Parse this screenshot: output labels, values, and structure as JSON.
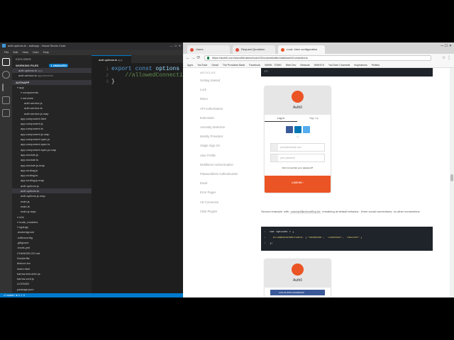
{
  "vscode": {
    "title": "auth.options.ts - authapp - Visual Studio Code",
    "menu": [
      "File",
      "Edit",
      "View",
      "Goto",
      "Help"
    ],
    "explorer_label": "EXPLORER",
    "working_files": "WORKING FILES",
    "working_badge": "1 UNSAVED",
    "open_files": [
      {
        "name": "auth.options.ts",
        "dir": "app"
      },
      {
        "name": "auth.service.ts",
        "dir": "app/services"
      }
    ],
    "project": "AUTHAPP",
    "tree": [
      {
        "name": "app",
        "indent": 1,
        "folder": true
      },
      {
        "name": "components",
        "indent": 2,
        "folder": true
      },
      {
        "name": "services",
        "indent": 2,
        "folder": true
      },
      {
        "name": "auth.service.js",
        "indent": 3
      },
      {
        "name": "auth.service.ts",
        "indent": 3
      },
      {
        "name": "auth.service.js.map",
        "indent": 3
      },
      {
        "name": "app.component.html",
        "indent": 2
      },
      {
        "name": "app.component.js",
        "indent": 2
      },
      {
        "name": "app.component.ts",
        "indent": 2
      },
      {
        "name": "app.component.js.map",
        "indent": 2
      },
      {
        "name": "app.component.spec.js",
        "indent": 2
      },
      {
        "name": "app.component.spec.ts",
        "indent": 2
      },
      {
        "name": "app.component.spec.js.map",
        "indent": 2
      },
      {
        "name": "app.module.js",
        "indent": 2
      },
      {
        "name": "app.module.ts",
        "indent": 2
      },
      {
        "name": "app.module.js.map",
        "indent": 2
      },
      {
        "name": "app.routing.js",
        "indent": 2
      },
      {
        "name": "app.routing.ts",
        "indent": 2
      },
      {
        "name": "app.routing.js.map",
        "indent": 2
      },
      {
        "name": "auth.options.js",
        "indent": 2
      },
      {
        "name": "auth.options.ts",
        "indent": 2,
        "selected": true
      },
      {
        "name": "auth.options.js.map",
        "indent": 2
      },
      {
        "name": "main.js",
        "indent": 2
      },
      {
        "name": "main.ts",
        "indent": 2
      },
      {
        "name": "main.js.map",
        "indent": 2
      },
      {
        "name": "e2e",
        "indent": 1,
        "folder": true
      },
      {
        "name": "node_modules",
        "indent": 1,
        "folder": true
      },
      {
        "name": "typings",
        "indent": 1,
        "folder": true
      },
      {
        "name": ".dockerignore",
        "indent": 1
      },
      {
        "name": ".editorconfig",
        "indent": 1
      },
      {
        "name": ".gitignore",
        "indent": 1
      },
      {
        "name": ".travis.yml",
        "indent": 1
      },
      {
        "name": "CHANGELOG.md",
        "indent": 1
      },
      {
        "name": "Dockerfile",
        "indent": 1
      },
      {
        "name": "favicon.ico",
        "indent": 1
      },
      {
        "name": "index.html",
        "indent": 1
      },
      {
        "name": "karma-test-shim.js",
        "indent": 1
      },
      {
        "name": "karma.conf.js",
        "indent": 1
      },
      {
        "name": "LICENSE",
        "indent": 1
      },
      {
        "name": "package.json",
        "indent": 1
      }
    ],
    "tab": "auth.options.ts",
    "tab_dir": "app",
    "code": [
      {
        "n": "1",
        "kw": "export const",
        "id": " options",
        "rest": " = {"
      },
      {
        "n": "2",
        "cm": "    //allowedConnection"
      },
      {
        "n": "3",
        "rest": "}"
      }
    ],
    "status": "⎇ master*  ⊗ 0  ⚠ 0"
  },
  "chrome": {
    "tabs": [
      {
        "title": "Users",
        "color": "#dd4b39"
      },
      {
        "title": "Request Quotation",
        "color": "#dd4b39"
      },
      {
        "title": "Lock: User configuration",
        "color": "#eb5424",
        "active": true
      }
    ],
    "url": "https://auth0.com/docs/libraries/lock/v10/customization#allowedConnections",
    "bookmarks": [
      "Apps",
      "YouTube",
      "Gmail",
      "The Providers Bank",
      "Facebook",
      "WWW - TOMS",
      "Web Dev",
      "Network",
      "WWHCS",
      "YouTube Channels",
      "Inspirations",
      "Politics"
    ],
    "nav_heading": "ARTICLES",
    "nav": [
      "Getting Started",
      "Lock",
      "Rules",
      "API Authorization",
      "Extensions",
      "Anomaly Detection",
      "Identity Providers",
      "Single Sign On",
      "User Profile",
      "Multifactor Authentication",
      "Passwordless Authentication",
      "Email",
      "Error Pages",
      "AD Connector",
      "CMS Plugins"
    ],
    "code_top": "});",
    "lock1": {
      "name": "Auth0",
      "login": "Log In",
      "signup": "Sign Up",
      "or": "or",
      "email": "yours@example.com",
      "password": "your password",
      "forgot": "Don't remember your password?",
      "submit": "LOG IN ›"
    },
    "para": {
      "pre": "Second example, with ",
      "code": "socialButtonStyle",
      "post": " remaining at default behavior - three social connections, no other connections"
    },
    "code2": [
      {
        "n": "1",
        "text": "var options = {"
      },
      {
        "n": "2",
        "text": "  allowedConnections: ['facebook', 'linkedin', 'twitter']"
      },
      {
        "n": "3",
        "text": "};"
      }
    ],
    "lock2": {
      "name": "Auth0",
      "fb": "LOG IN WITH FACEBOOK"
    }
  }
}
